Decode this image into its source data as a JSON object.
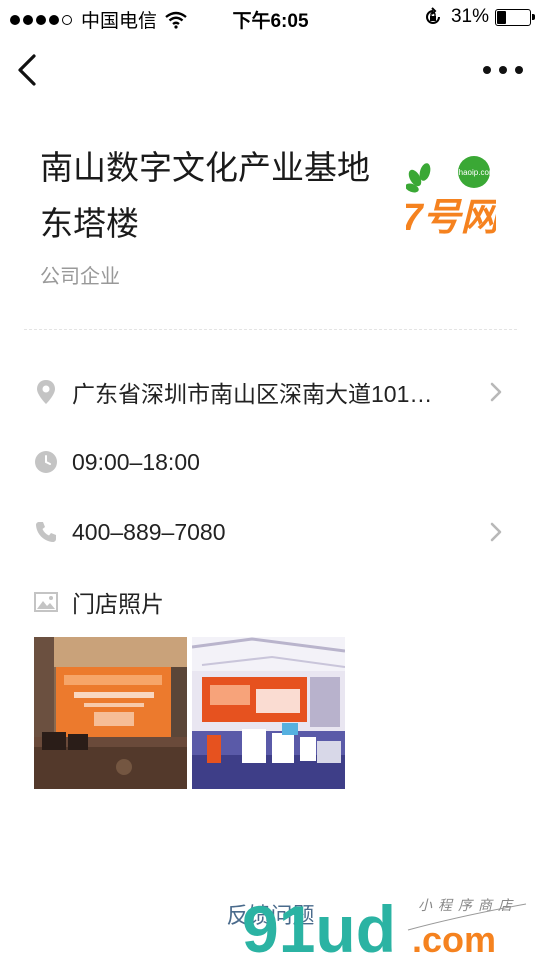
{
  "status_bar": {
    "carrier": "中国电信",
    "time": "下午6:05",
    "battery_percent": "31%",
    "battery_level": 0.31,
    "signal_bars_filled": 4,
    "signal_bars_total": 5
  },
  "navbar": {
    "back_icon": "chevron-left-icon",
    "more_icon": "more-dots-icon"
  },
  "place": {
    "title": "南山数字文化产业基地东塔楼",
    "category": "公司企业",
    "logo_text": "7号网",
    "logo_domain": "qihaoip.com"
  },
  "info": {
    "address": "广东省深圳市南山区深南大道101…",
    "hours": "09:00–18:00",
    "phone": "400–889–7080",
    "photos_label": "门店照片"
  },
  "footer": {
    "feedback": "反馈问题"
  },
  "watermark": {
    "brand": "91ud",
    "suffix": ".com",
    "tagline": "小程序商店"
  },
  "colors": {
    "icon_gray": "#c4c4c4",
    "feedback": "#4a6b8c",
    "logo_orange": "#f5821f",
    "logo_green": "#3aa835",
    "watermark_teal": "#2bb3a3"
  }
}
